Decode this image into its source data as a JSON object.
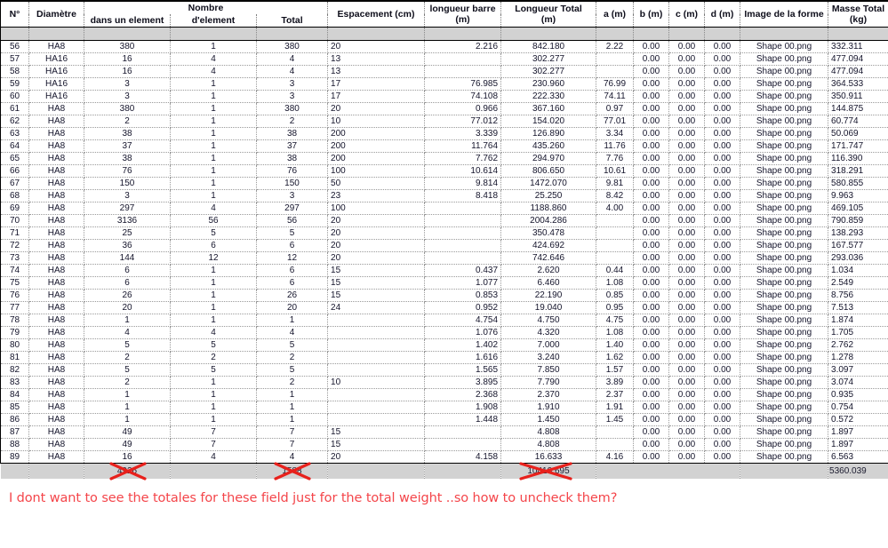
{
  "table": {
    "header": {
      "group_label": "Nombre",
      "columns": [
        {
          "key": "no",
          "label": "N°"
        },
        {
          "key": "diametre",
          "label": "Diamètre"
        },
        {
          "key": "dans_elem",
          "label": "dans un element"
        },
        {
          "key": "d_element",
          "label": "d'element"
        },
        {
          "key": "total",
          "label": "Total"
        },
        {
          "key": "espacement",
          "label": "Espacement (cm)"
        },
        {
          "key": "long_barre",
          "label": "longueur barre (m)"
        },
        {
          "key": "long_total",
          "label": "Longueur Total (m)"
        },
        {
          "key": "a",
          "label": "a (m)"
        },
        {
          "key": "b",
          "label": "b (m)"
        },
        {
          "key": "c",
          "label": "c (m)"
        },
        {
          "key": "d",
          "label": "d (m)"
        },
        {
          "key": "image",
          "label": "Image de la forme"
        },
        {
          "key": "masse",
          "label": "Masse Total (kg)"
        }
      ],
      "long_barre_l1": "longueur barre",
      "long_barre_l2": "(m)",
      "long_total_l1": "Longueur Total",
      "long_total_l2": "(m)",
      "masse_l1": "Masse Total",
      "masse_l2": "(kg)"
    },
    "rows": [
      {
        "no": "56",
        "diametre": "HA8",
        "dans_elem": "380",
        "d_element": "1",
        "total": "380",
        "espacement": "20",
        "long_barre": "2.216",
        "long_total": "842.180",
        "a": "2.22",
        "b": "0.00",
        "c": "0.00",
        "d": "0.00",
        "image": "Shape 00.png",
        "masse": "332.311"
      },
      {
        "no": "57",
        "diametre": "HA16",
        "dans_elem": "16",
        "d_element": "4",
        "total": "4",
        "espacement": "13",
        "long_barre": "",
        "long_total": "302.277",
        "a": "",
        "b": "0.00",
        "c": "0.00",
        "d": "0.00",
        "image": "Shape 00.png",
        "masse": "477.094"
      },
      {
        "no": "58",
        "diametre": "HA16",
        "dans_elem": "16",
        "d_element": "4",
        "total": "4",
        "espacement": "13",
        "long_barre": "",
        "long_total": "302.277",
        "a": "",
        "b": "0.00",
        "c": "0.00",
        "d": "0.00",
        "image": "Shape 00.png",
        "masse": "477.094"
      },
      {
        "no": "59",
        "diametre": "HA16",
        "dans_elem": "3",
        "d_element": "1",
        "total": "3",
        "espacement": "17",
        "long_barre": "76.985",
        "long_total": "230.960",
        "a": "76.99",
        "b": "0.00",
        "c": "0.00",
        "d": "0.00",
        "image": "Shape 00.png",
        "masse": "364.533"
      },
      {
        "no": "60",
        "diametre": "HA16",
        "dans_elem": "3",
        "d_element": "1",
        "total": "3",
        "espacement": "17",
        "long_barre": "74.108",
        "long_total": "222.330",
        "a": "74.11",
        "b": "0.00",
        "c": "0.00",
        "d": "0.00",
        "image": "Shape 00.png",
        "masse": "350.911"
      },
      {
        "no": "61",
        "diametre": "HA8",
        "dans_elem": "380",
        "d_element": "1",
        "total": "380",
        "espacement": "20",
        "long_barre": "0.966",
        "long_total": "367.160",
        "a": "0.97",
        "b": "0.00",
        "c": "0.00",
        "d": "0.00",
        "image": "Shape 00.png",
        "masse": "144.875"
      },
      {
        "no": "62",
        "diametre": "HA8",
        "dans_elem": "2",
        "d_element": "1",
        "total": "2",
        "espacement": "10",
        "long_barre": "77.012",
        "long_total": "154.020",
        "a": "77.01",
        "b": "0.00",
        "c": "0.00",
        "d": "0.00",
        "image": "Shape 00.png",
        "masse": "60.774"
      },
      {
        "no": "63",
        "diametre": "HA8",
        "dans_elem": "38",
        "d_element": "1",
        "total": "38",
        "espacement": "200",
        "long_barre": "3.339",
        "long_total": "126.890",
        "a": "3.34",
        "b": "0.00",
        "c": "0.00",
        "d": "0.00",
        "image": "Shape 00.png",
        "masse": "50.069"
      },
      {
        "no": "64",
        "diametre": "HA8",
        "dans_elem": "37",
        "d_element": "1",
        "total": "37",
        "espacement": "200",
        "long_barre": "11.764",
        "long_total": "435.260",
        "a": "11.76",
        "b": "0.00",
        "c": "0.00",
        "d": "0.00",
        "image": "Shape 00.png",
        "masse": "171.747"
      },
      {
        "no": "65",
        "diametre": "HA8",
        "dans_elem": "38",
        "d_element": "1",
        "total": "38",
        "espacement": "200",
        "long_barre": "7.762",
        "long_total": "294.970",
        "a": "7.76",
        "b": "0.00",
        "c": "0.00",
        "d": "0.00",
        "image": "Shape 00.png",
        "masse": "116.390"
      },
      {
        "no": "66",
        "diametre": "HA8",
        "dans_elem": "76",
        "d_element": "1",
        "total": "76",
        "espacement": "100",
        "long_barre": "10.614",
        "long_total": "806.650",
        "a": "10.61",
        "b": "0.00",
        "c": "0.00",
        "d": "0.00",
        "image": "Shape 00.png",
        "masse": "318.291"
      },
      {
        "no": "67",
        "diametre": "HA8",
        "dans_elem": "150",
        "d_element": "1",
        "total": "150",
        "espacement": "50",
        "long_barre": "9.814",
        "long_total": "1472.070",
        "a": "9.81",
        "b": "0.00",
        "c": "0.00",
        "d": "0.00",
        "image": "Shape 00.png",
        "masse": "580.855"
      },
      {
        "no": "68",
        "diametre": "HA8",
        "dans_elem": "3",
        "d_element": "1",
        "total": "3",
        "espacement": "23",
        "long_barre": "8.418",
        "long_total": "25.250",
        "a": "8.42",
        "b": "0.00",
        "c": "0.00",
        "d": "0.00",
        "image": "Shape 00.png",
        "masse": "9.963"
      },
      {
        "no": "69",
        "diametre": "HA8",
        "dans_elem": "297",
        "d_element": "4",
        "total": "297",
        "espacement": "100",
        "long_barre": "",
        "long_total": "1188.860",
        "a": "4.00",
        "b": "0.00",
        "c": "0.00",
        "d": "0.00",
        "image": "Shape 00.png",
        "masse": "469.105"
      },
      {
        "no": "70",
        "diametre": "HA8",
        "dans_elem": "3136",
        "d_element": "56",
        "total": "56",
        "espacement": "20",
        "long_barre": "",
        "long_total": "2004.286",
        "a": "",
        "b": "0.00",
        "c": "0.00",
        "d": "0.00",
        "image": "Shape 00.png",
        "masse": "790.859"
      },
      {
        "no": "71",
        "diametre": "HA8",
        "dans_elem": "25",
        "d_element": "5",
        "total": "5",
        "espacement": "20",
        "long_barre": "",
        "long_total": "350.478",
        "a": "",
        "b": "0.00",
        "c": "0.00",
        "d": "0.00",
        "image": "Shape 00.png",
        "masse": "138.293"
      },
      {
        "no": "72",
        "diametre": "HA8",
        "dans_elem": "36",
        "d_element": "6",
        "total": "6",
        "espacement": "20",
        "long_barre": "",
        "long_total": "424.692",
        "a": "",
        "b": "0.00",
        "c": "0.00",
        "d": "0.00",
        "image": "Shape 00.png",
        "masse": "167.577"
      },
      {
        "no": "73",
        "diametre": "HA8",
        "dans_elem": "144",
        "d_element": "12",
        "total": "12",
        "espacement": "20",
        "long_barre": "",
        "long_total": "742.646",
        "a": "",
        "b": "0.00",
        "c": "0.00",
        "d": "0.00",
        "image": "Shape 00.png",
        "masse": "293.036"
      },
      {
        "no": "74",
        "diametre": "HA8",
        "dans_elem": "6",
        "d_element": "1",
        "total": "6",
        "espacement": "15",
        "long_barre": "0.437",
        "long_total": "2.620",
        "a": "0.44",
        "b": "0.00",
        "c": "0.00",
        "d": "0.00",
        "image": "Shape 00.png",
        "masse": "1.034"
      },
      {
        "no": "75",
        "diametre": "HA8",
        "dans_elem": "6",
        "d_element": "1",
        "total": "6",
        "espacement": "15",
        "long_barre": "1.077",
        "long_total": "6.460",
        "a": "1.08",
        "b": "0.00",
        "c": "0.00",
        "d": "0.00",
        "image": "Shape 00.png",
        "masse": "2.549"
      },
      {
        "no": "76",
        "diametre": "HA8",
        "dans_elem": "26",
        "d_element": "1",
        "total": "26",
        "espacement": "15",
        "long_barre": "0.853",
        "long_total": "22.190",
        "a": "0.85",
        "b": "0.00",
        "c": "0.00",
        "d": "0.00",
        "image": "Shape 00.png",
        "masse": "8.756"
      },
      {
        "no": "77",
        "diametre": "HA8",
        "dans_elem": "20",
        "d_element": "1",
        "total": "20",
        "espacement": "24",
        "long_barre": "0.952",
        "long_total": "19.040",
        "a": "0.95",
        "b": "0.00",
        "c": "0.00",
        "d": "0.00",
        "image": "Shape 00.png",
        "masse": "7.513"
      },
      {
        "no": "78",
        "diametre": "HA8",
        "dans_elem": "1",
        "d_element": "1",
        "total": "1",
        "espacement": "",
        "long_barre": "4.754",
        "long_total": "4.750",
        "a": "4.75",
        "b": "0.00",
        "c": "0.00",
        "d": "0.00",
        "image": "Shape 00.png",
        "masse": "1.874"
      },
      {
        "no": "79",
        "diametre": "HA8",
        "dans_elem": "4",
        "d_element": "4",
        "total": "4",
        "espacement": "",
        "long_barre": "1.076",
        "long_total": "4.320",
        "a": "1.08",
        "b": "0.00",
        "c": "0.00",
        "d": "0.00",
        "image": "Shape 00.png",
        "masse": "1.705"
      },
      {
        "no": "80",
        "diametre": "HA8",
        "dans_elem": "5",
        "d_element": "5",
        "total": "5",
        "espacement": "",
        "long_barre": "1.402",
        "long_total": "7.000",
        "a": "1.40",
        "b": "0.00",
        "c": "0.00",
        "d": "0.00",
        "image": "Shape 00.png",
        "masse": "2.762"
      },
      {
        "no": "81",
        "diametre": "HA8",
        "dans_elem": "2",
        "d_element": "2",
        "total": "2",
        "espacement": "",
        "long_barre": "1.616",
        "long_total": "3.240",
        "a": "1.62",
        "b": "0.00",
        "c": "0.00",
        "d": "0.00",
        "image": "Shape 00.png",
        "masse": "1.278"
      },
      {
        "no": "82",
        "diametre": "HA8",
        "dans_elem": "5",
        "d_element": "5",
        "total": "5",
        "espacement": "",
        "long_barre": "1.565",
        "long_total": "7.850",
        "a": "1.57",
        "b": "0.00",
        "c": "0.00",
        "d": "0.00",
        "image": "Shape 00.png",
        "masse": "3.097"
      },
      {
        "no": "83",
        "diametre": "HA8",
        "dans_elem": "2",
        "d_element": "1",
        "total": "2",
        "espacement": "10",
        "long_barre": "3.895",
        "long_total": "7.790",
        "a": "3.89",
        "b": "0.00",
        "c": "0.00",
        "d": "0.00",
        "image": "Shape 00.png",
        "masse": "3.074"
      },
      {
        "no": "84",
        "diametre": "HA8",
        "dans_elem": "1",
        "d_element": "1",
        "total": "1",
        "espacement": "",
        "long_barre": "2.368",
        "long_total": "2.370",
        "a": "2.37",
        "b": "0.00",
        "c": "0.00",
        "d": "0.00",
        "image": "Shape 00.png",
        "masse": "0.935"
      },
      {
        "no": "85",
        "diametre": "HA8",
        "dans_elem": "1",
        "d_element": "1",
        "total": "1",
        "espacement": "",
        "long_barre": "1.908",
        "long_total": "1.910",
        "a": "1.91",
        "b": "0.00",
        "c": "0.00",
        "d": "0.00",
        "image": "Shape 00.png",
        "masse": "0.754"
      },
      {
        "no": "86",
        "diametre": "HA8",
        "dans_elem": "1",
        "d_element": "1",
        "total": "1",
        "espacement": "",
        "long_barre": "1.448",
        "long_total": "1.450",
        "a": "1.45",
        "b": "0.00",
        "c": "0.00",
        "d": "0.00",
        "image": "Shape 00.png",
        "masse": "0.572"
      },
      {
        "no": "87",
        "diametre": "HA8",
        "dans_elem": "49",
        "d_element": "7",
        "total": "7",
        "espacement": "15",
        "long_barre": "",
        "long_total": "4.808",
        "a": "",
        "b": "0.00",
        "c": "0.00",
        "d": "0.00",
        "image": "Shape 00.png",
        "masse": "1.897"
      },
      {
        "no": "88",
        "diametre": "HA8",
        "dans_elem": "49",
        "d_element": "7",
        "total": "7",
        "espacement": "15",
        "long_barre": "",
        "long_total": "4.808",
        "a": "",
        "b": "0.00",
        "c": "0.00",
        "d": "0.00",
        "image": "Shape 00.png",
        "masse": "1.897"
      },
      {
        "no": "89",
        "diametre": "HA8",
        "dans_elem": "16",
        "d_element": "4",
        "total": "4",
        "espacement": "20",
        "long_barre": "4.158",
        "long_total": "16.633",
        "a": "4.16",
        "b": "0.00",
        "c": "0.00",
        "d": "0.00",
        "image": "Shape 00.png",
        "masse": "6.563"
      }
    ],
    "totals": {
      "dans_elem": "4926",
      "total": "1588",
      "long_total": "10410.695",
      "masse": "5360.039"
    }
  },
  "annotation": {
    "text": "I dont want to see the totales for these field just for the total weight ..so how to uncheck them?",
    "color": "#f4454a",
    "strike_marks": [
      "cross-out-dans-element-total",
      "cross-out-total-total",
      "cross-out-longueur-total"
    ]
  }
}
